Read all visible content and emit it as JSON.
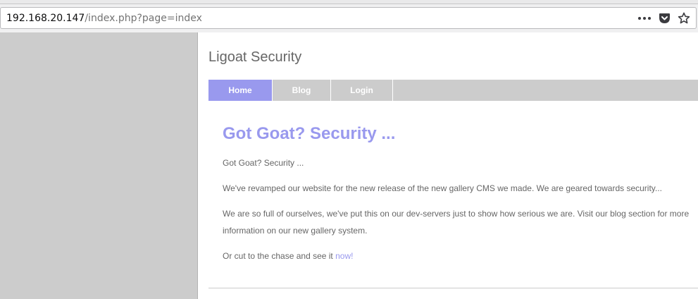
{
  "browser": {
    "url_host": "192.168.20.147",
    "url_path": "/index.php?page=index",
    "icons": [
      "more-icon",
      "pocket-icon",
      "bookmark-star-icon"
    ]
  },
  "site": {
    "title": "Ligoat Security"
  },
  "nav": {
    "items": [
      {
        "label": "Home",
        "active": true
      },
      {
        "label": "Blog",
        "active": false
      },
      {
        "label": "Login",
        "active": false
      }
    ]
  },
  "article": {
    "headline": "Got Goat? Security ...",
    "paragraphs": [
      "Got Goat? Security ...",
      "We've revamped our website for the new release of the new gallery CMS we made. We are geared towards security...",
      "We are so full of ourselves, we've put this on our dev-servers just to show how serious we are. Visit our blog section for more information on our new gallery system."
    ],
    "cta_text": "Or cut to the chase and see it ",
    "cta_link": "now!"
  },
  "colors": {
    "accent": "#9999ee",
    "nav_bg": "#cccccc",
    "text": "#666666"
  }
}
